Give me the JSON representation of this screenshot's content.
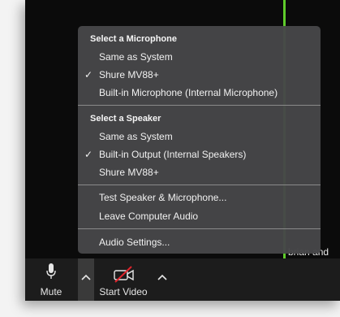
{
  "video": {
    "participant_name": "brian and Debi"
  },
  "audio_menu": {
    "microphone_heading": "Select a Microphone",
    "microphones": [
      {
        "label": "Same as System",
        "selected": false
      },
      {
        "label": "Shure MV88+",
        "selected": true
      },
      {
        "label": "Built-in Microphone (Internal Microphone)",
        "selected": false
      }
    ],
    "speaker_heading": "Select a Speaker",
    "speakers": [
      {
        "label": "Same as System",
        "selected": false
      },
      {
        "label": "Built-in Output (Internal Speakers)",
        "selected": true
      },
      {
        "label": "Shure MV88+",
        "selected": false
      }
    ],
    "test_label": "Test Speaker & Microphone...",
    "leave_label": "Leave Computer Audio",
    "settings_label": "Audio Settings...",
    "check_glyph": "✓"
  },
  "toolbar": {
    "mute_label": "Mute",
    "start_video_label": "Start Video",
    "mic_icon": "microphone-icon",
    "camera_icon": "camera-off-icon",
    "chevron_icon": "chevron-up-icon"
  },
  "colors": {
    "video_border": "#5fcb2b",
    "camera_off_slash": "#e0242c",
    "menu_background": "#464648",
    "window_background": "#0b0b0b"
  }
}
